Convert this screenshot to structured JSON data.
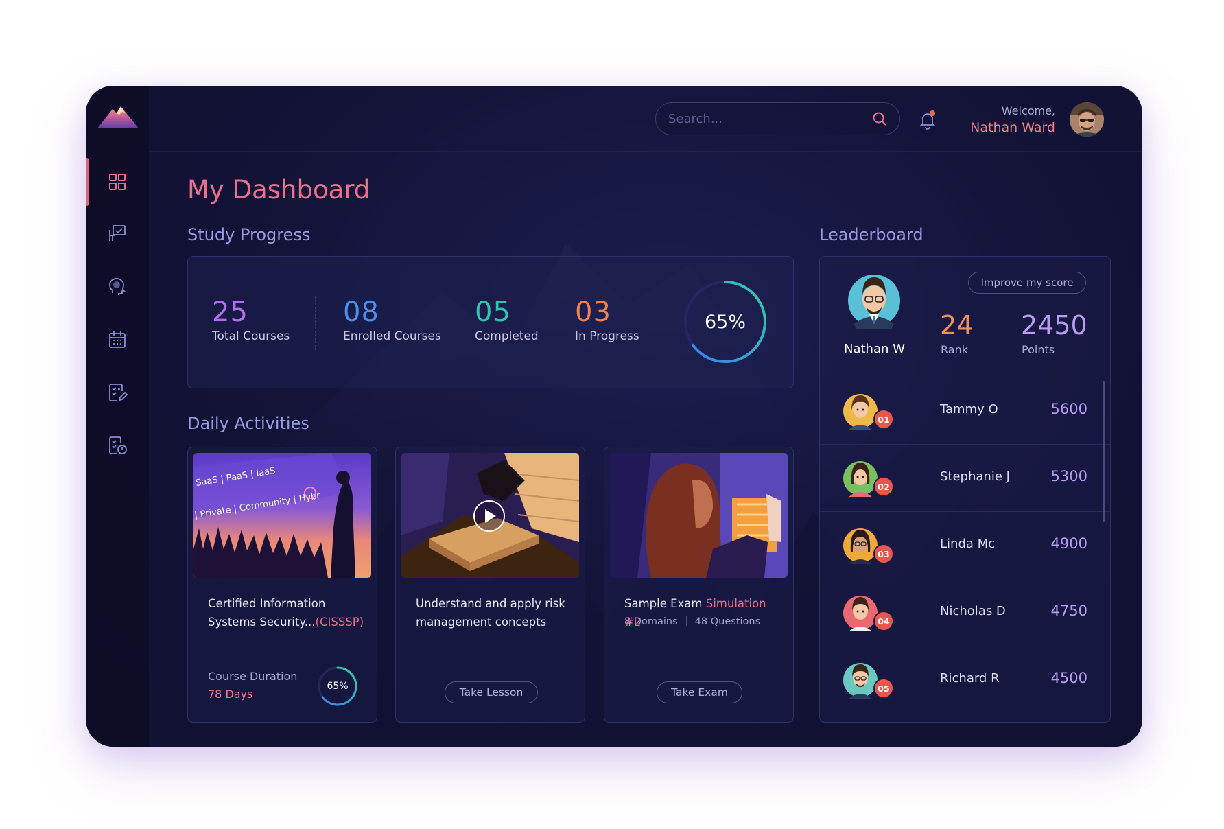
{
  "header": {
    "search_placeholder": "Search...",
    "welcome_label": "Welcome,",
    "user_name": "Nathan Ward"
  },
  "sidebar": {
    "items": [
      {
        "icon": "dashboard-grid-icon",
        "active": true
      },
      {
        "icon": "presentation-board-icon",
        "active": false
      },
      {
        "icon": "brain-head-icon",
        "active": false
      },
      {
        "icon": "calendar-icon",
        "active": false
      },
      {
        "icon": "checklist-edit-icon",
        "active": false
      },
      {
        "icon": "checklist-clock-icon",
        "active": false
      }
    ]
  },
  "page_title": "My Dashboard",
  "study_progress": {
    "title": "Study Progress",
    "stats": [
      {
        "value": "25",
        "label": "Total Courses",
        "color": "#b06ee8"
      },
      {
        "value": "08",
        "label": "Enrolled Courses",
        "color": "#4c8ef0"
      },
      {
        "value": "05",
        "label": "Completed",
        "color": "#2fc6b0"
      },
      {
        "value": "03",
        "label": "In Progress",
        "color": "#f0804e"
      }
    ],
    "overall_percent_label": "65%",
    "overall_fraction": 0.65
  },
  "daily_activities": {
    "title": "Daily Activities",
    "cards": [
      {
        "title_part1": "Certified Information Systems Security...",
        "title_highlight": "(CISSSP)",
        "duration_label": "Course Duration",
        "duration_value": "78 Days",
        "percent_label": "65%",
        "fraction": 0.65,
        "image_text_line1": "SaaS  |  PaaS  |  IaaS",
        "image_text_line2": "| Private | Community | Hybr"
      },
      {
        "title": "Understand and apply risk management concepts",
        "button_label": "Take Lesson"
      },
      {
        "title_part1": "Sample Exam ",
        "title_highlight": "Simulation #2",
        "domains": "8 Domains",
        "questions": "48 Questions",
        "button_label": "Take Exam"
      }
    ]
  },
  "leaderboard": {
    "title": "Leaderboard",
    "me": {
      "name": "Nathan W",
      "rank_value": "24",
      "rank_label": "Rank",
      "points_value": "2450",
      "points_label": "Points",
      "improve_label": "Improve my score"
    },
    "rows": [
      {
        "badge": "01",
        "name": "Tammy O",
        "score": "5600"
      },
      {
        "badge": "02",
        "name": "Stephanie J",
        "score": "5300"
      },
      {
        "badge": "03",
        "name": "Linda Mc",
        "score": "4900"
      },
      {
        "badge": "04",
        "name": "Nicholas D",
        "score": "4750"
      },
      {
        "badge": "05",
        "name": "Richard R",
        "score": "4500"
      }
    ]
  }
}
